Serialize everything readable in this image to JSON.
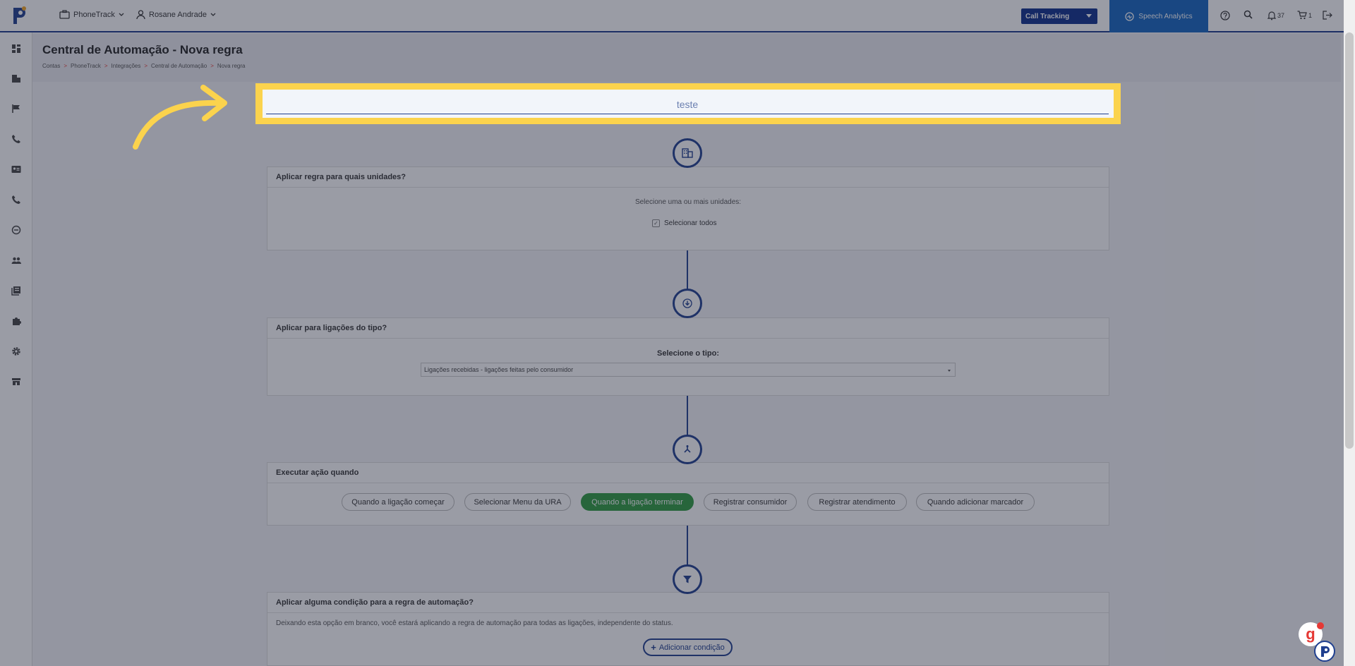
{
  "topbar": {
    "account_menu": "PhoneTrack",
    "user_menu": "Rosane Andrade",
    "call_tracking": "Call Tracking",
    "speech_analytics": "Speech Analytics",
    "notifications_count": "37",
    "cart_count": "1"
  },
  "page": {
    "title": "Central de Automação - Nova regra",
    "breadcrumb": [
      "Contas",
      "PhoneTrack",
      "Integrações",
      "Central de Automação",
      "Nova regra"
    ],
    "breadcrumb_sep": ">"
  },
  "rule_name": {
    "value": "teste"
  },
  "units": {
    "heading": "Aplicar regra para quais unidades?",
    "prompt": "Selecione uma ou mais unidades:",
    "select_all": "Selecionar todos"
  },
  "call_type": {
    "heading": "Aplicar para ligações do tipo?",
    "prompt": "Selecione o tipo:",
    "selected": "Ligações recebidas - ligações feitas pelo consumidor"
  },
  "trigger": {
    "heading": "Executar ação quando",
    "options": [
      "Quando a ligação começar",
      "Selecionar Menu da URA",
      "Quando a ligação terminar",
      "Registrar consumidor",
      "Registrar atendimento",
      "Quando adicionar marcador"
    ],
    "active": "Quando a ligação terminar"
  },
  "condition": {
    "heading": "Aplicar alguma condição para a regra de automação?",
    "hint": "Deixando esta opção em branco, você estará aplicando a regra de automação para todas as ligações, independente do status.",
    "add_label": "Adicionar condição"
  },
  "colors": {
    "brand": "#0d2f8a",
    "accent_green": "#2e9c3f",
    "highlight": "#fbd34d"
  }
}
